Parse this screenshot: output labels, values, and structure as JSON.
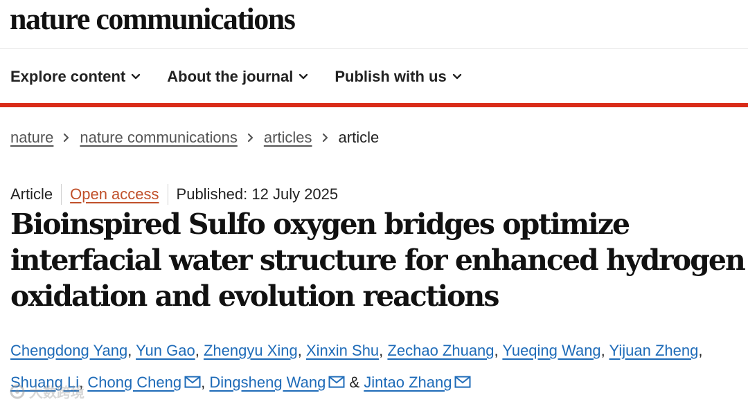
{
  "header": {
    "brand": "nature communications"
  },
  "nav": {
    "items": [
      {
        "label": "Explore content",
        "icon": "chevron-down-icon"
      },
      {
        "label": "About the journal",
        "icon": "chevron-down-icon"
      },
      {
        "label": "Publish with us",
        "icon": "chevron-down-icon"
      }
    ]
  },
  "accent_color": "#d92b18",
  "breadcrumb": {
    "items": [
      "nature",
      "nature communications",
      "articles"
    ],
    "current": "article",
    "separator_icon": "chevron-right-icon"
  },
  "article": {
    "type": "Article",
    "access": "Open access",
    "published": "Published: 12 July 2025",
    "title": "Bioinspired Sulfo oxygen bridges optimize interfacial water structure for enhanced hydrogen oxidation and evolution reactions",
    "authors": [
      "Chengdong Yang",
      "Yun Gao",
      "Zhengyu Xing",
      "Xinxin Shu",
      "Zechao Zhuang",
      "Yueqing Wang",
      "Yijuan Zheng",
      "Shuang Li",
      "Chong Cheng",
      "Dingsheng Wang",
      "Jintao Zhang"
    ],
    "author_separator": ",",
    "author_conjunction": "&",
    "corresponding_icon": "mail-icon"
  },
  "watermark": {
    "text": "大数跨境",
    "icon": "logo-icon"
  }
}
